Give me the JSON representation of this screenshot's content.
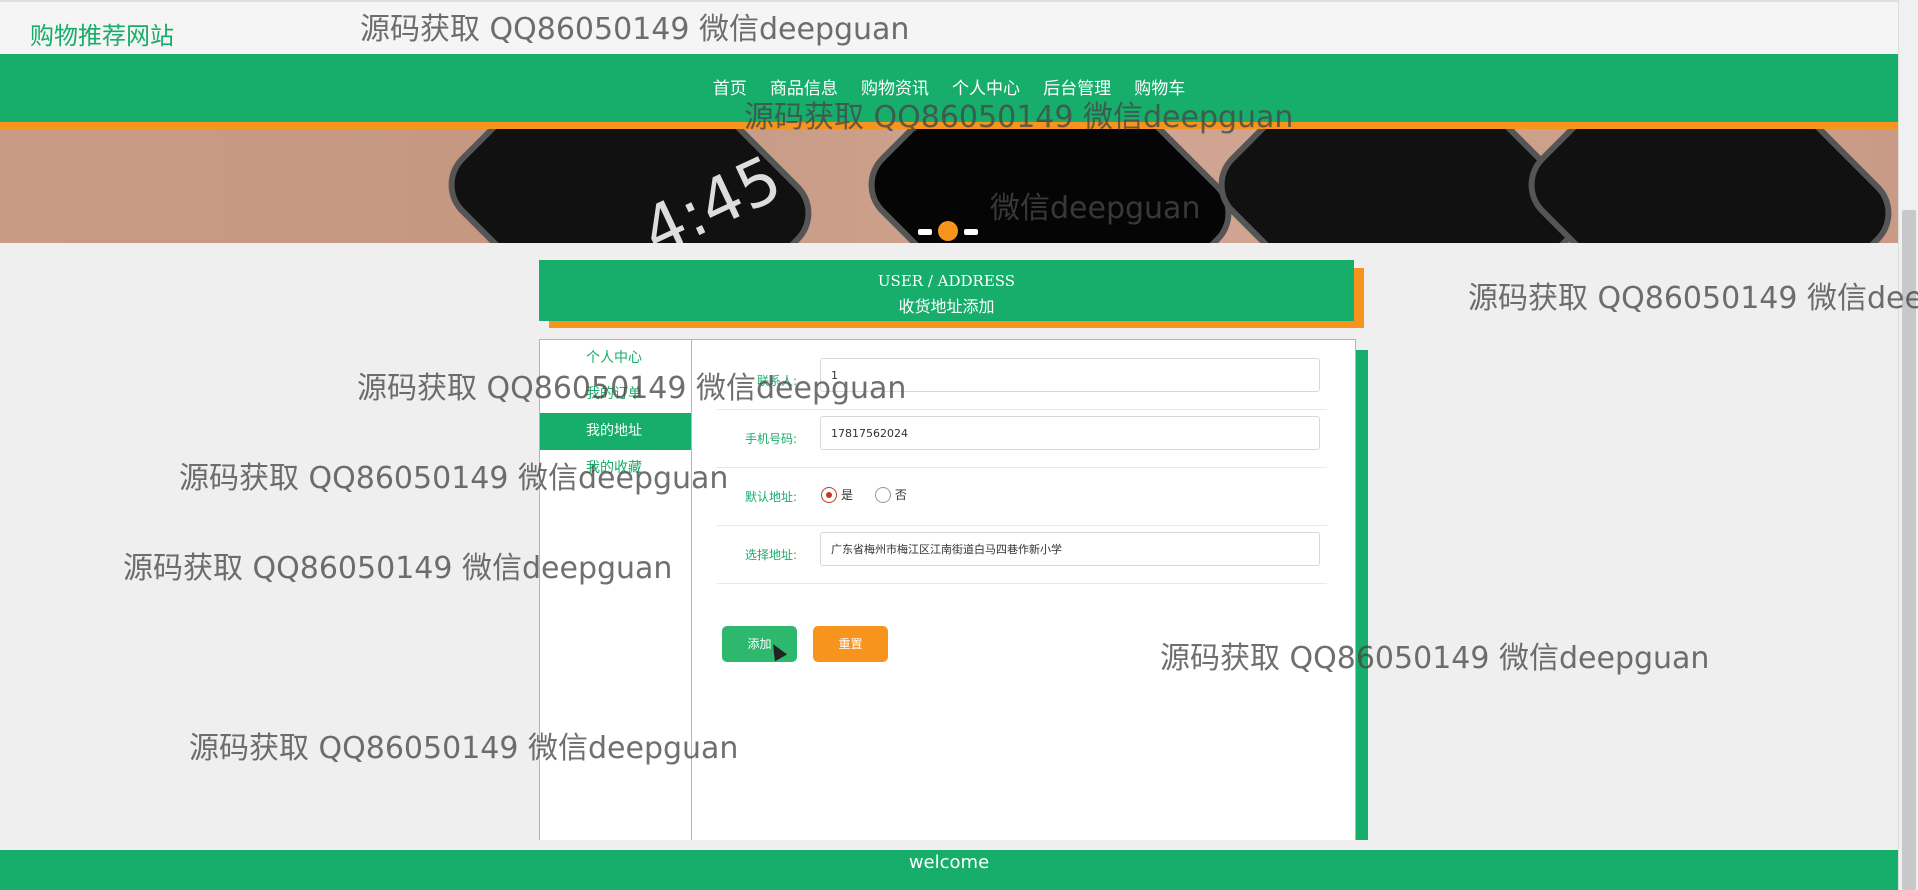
{
  "site": {
    "title": "购物推荐网站"
  },
  "nav": {
    "items": [
      "首页",
      "商品信息",
      "购物资讯",
      "个人中心",
      "后台管理",
      "购物车"
    ]
  },
  "banner": {
    "clock_text": "4:45"
  },
  "section": {
    "title_en": "USER / ADDRESS",
    "title_cn": "收货地址添加"
  },
  "sidebar": {
    "items": [
      {
        "label": "个人中心",
        "active": false
      },
      {
        "label": "我的订单",
        "active": false
      },
      {
        "label": "我的地址",
        "active": true
      },
      {
        "label": "我的收藏",
        "active": false
      }
    ]
  },
  "form": {
    "contact_label": "联系人:",
    "contact_value": "1",
    "phone_label": "手机号码:",
    "phone_value": "17817562024",
    "default_label": "默认地址:",
    "default_yes": "是",
    "default_no": "否",
    "address_label": "选择地址:",
    "address_value": "广东省梅州市梅江区江南街道白马四巷作新小学",
    "add_button": "添加",
    "reset_button": "重置"
  },
  "footer": {
    "text": "welcome"
  },
  "watermarks": [
    "源码获取 QQ86050149 微信deepguan",
    "源码获取 QQ86050149 微信deepguan",
    "微信deepguan",
    "源码获取 QQ86050149 微信deep",
    "源码获取 QQ86050149 微信deepguan",
    "源码获取 QQ86050149 微信deepguan",
    "源码获取 QQ86050149 微信deepguan",
    "源码获取 QQ86050149 微信deepguan",
    "源码获取 QQ86050149 微信deepguan"
  ],
  "colors": {
    "primary": "#17ad6a",
    "accent": "#f7941d"
  }
}
